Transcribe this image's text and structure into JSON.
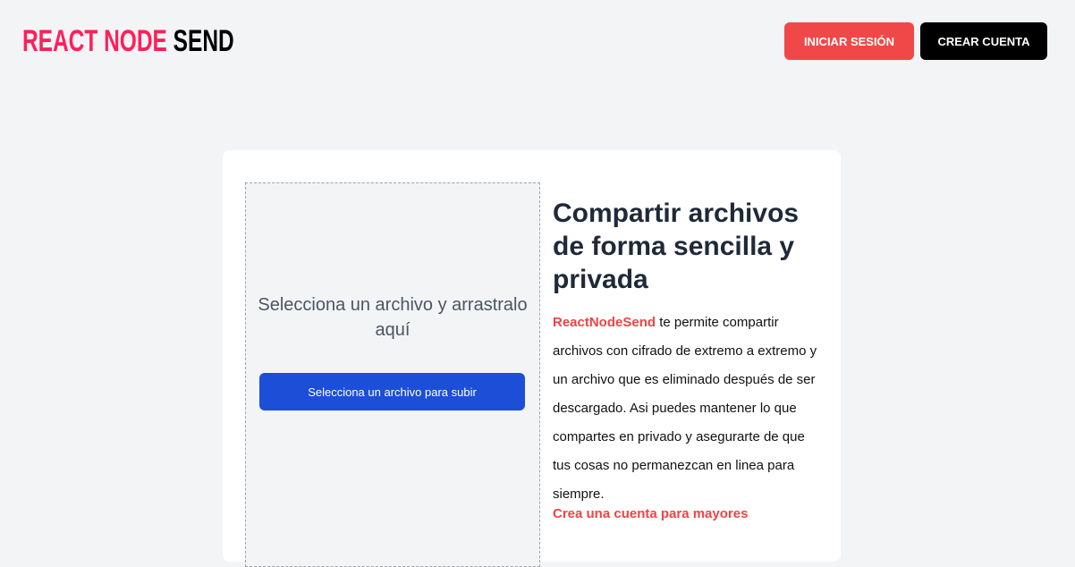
{
  "header": {
    "logo_part1": "REACT NODE",
    "logo_part2": "SEND",
    "login_label": "INICIAR SESIÓN",
    "signup_label": "CREAR CUENTA"
  },
  "dropzone": {
    "prompt": "Selecciona un archivo y arrastralo aquí",
    "button_label": "Selecciona un archivo para subir"
  },
  "info": {
    "title": "Compartir archivos de forma sencilla y privada",
    "brand": "ReactNodeSend",
    "description": " te permite compartir archivos con cifrado de extremo a extremo y un archivo que es eliminado después de ser descargado. Asi puedes mantener lo que compartes en privado y asegurarte de que tus cosas no permanezcan en linea para siempre.",
    "cta": "Crea una cuenta para mayores"
  },
  "colors": {
    "brand": "#ff1f5a",
    "accent": "#f04848",
    "primary": "#1d4ed8"
  }
}
